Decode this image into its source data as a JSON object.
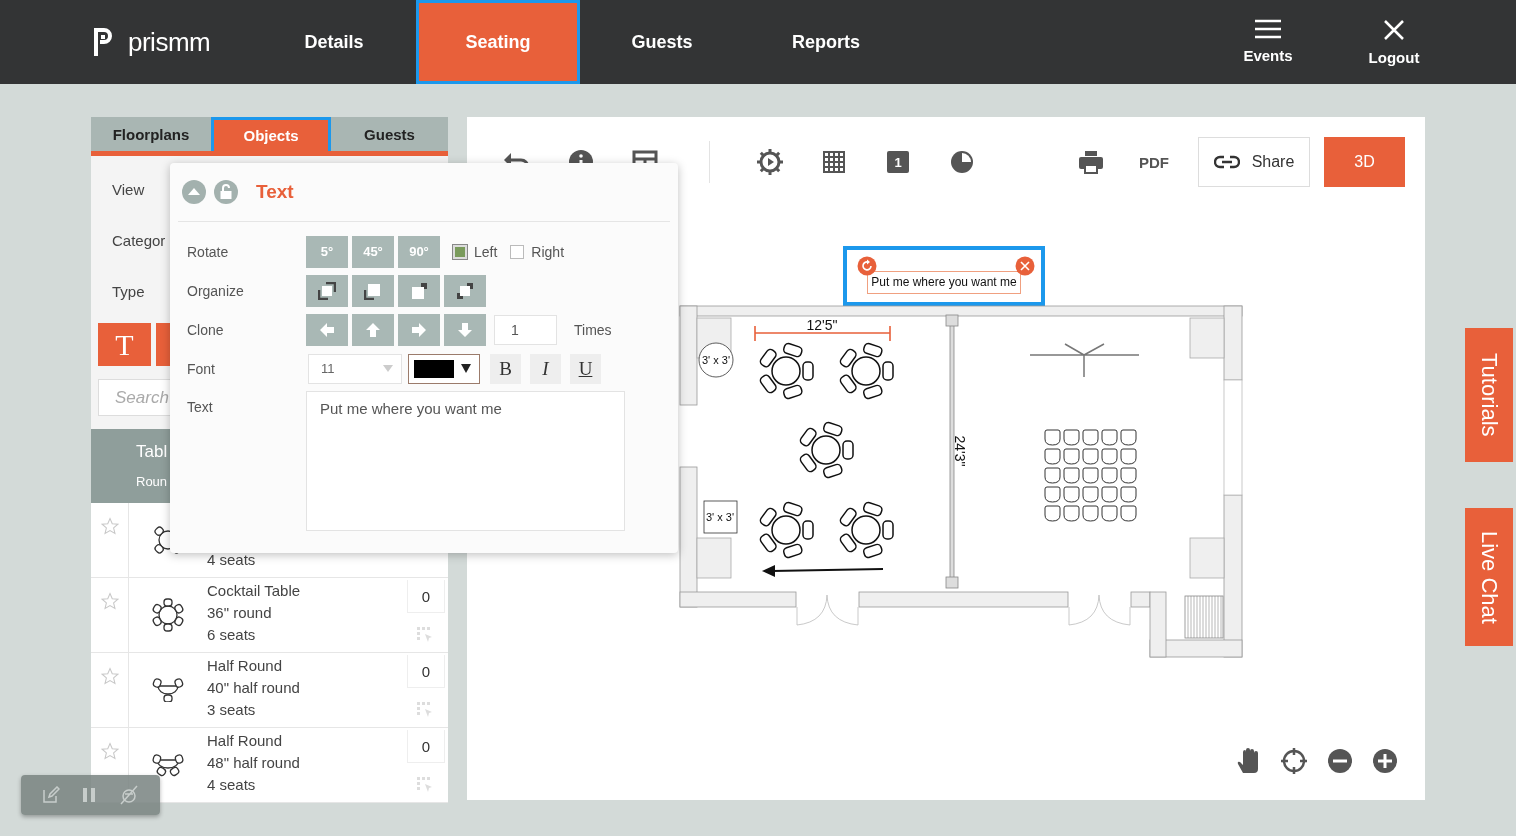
{
  "logo": {
    "text": "prismm"
  },
  "nav": [
    {
      "label": "Details",
      "selected": false,
      "highlighted": false
    },
    {
      "label": "Seating",
      "selected": true,
      "highlighted": true
    },
    {
      "label": "Guests",
      "selected": false,
      "highlighted": false
    },
    {
      "label": "Reports",
      "selected": false,
      "highlighted": false
    }
  ],
  "header_actions": [
    {
      "kind": "menu",
      "label": "Events"
    },
    {
      "kind": "close",
      "label": "Logout"
    }
  ],
  "sidebar": {
    "tabs": [
      {
        "label": "Floorplans",
        "selected": false,
        "highlighted": false
      },
      {
        "label": "Objects",
        "selected": true,
        "highlighted": true
      },
      {
        "label": "Guests",
        "selected": false,
        "highlighted": false
      }
    ],
    "filters": [
      {
        "label": "View"
      },
      {
        "label": "Categor"
      },
      {
        "label": "Type"
      }
    ],
    "type_buttons": [
      {
        "kind": "text",
        "label": "T"
      },
      {
        "kind": "blank"
      }
    ],
    "search": {
      "placeholder": "Search"
    },
    "group": {
      "title": "Tabl",
      "subtitle": "Roun"
    },
    "items": [
      {
        "kind": "round4",
        "lines": [
          "4 seats"
        ]
      },
      {
        "kind": "round6",
        "lines": [
          "Cocktail Table",
          "36\" round",
          "6 seats"
        ],
        "count": "0"
      },
      {
        "kind": "half3",
        "lines": [
          "Half Round",
          "40\" half round",
          "3 seats"
        ],
        "count": "0"
      },
      {
        "kind": "half4",
        "lines": [
          "Half Round",
          "48\" half round",
          "4 seats"
        ],
        "count": "0"
      }
    ]
  },
  "text_editor": {
    "title": "Text",
    "rotate": {
      "label": "Rotate",
      "steps": [
        "5°",
        "45°",
        "90°"
      ],
      "directions": [
        {
          "label": "Left",
          "checked": true
        },
        {
          "label": "Right",
          "checked": false
        }
      ]
    },
    "organize": {
      "label": "Organize"
    },
    "clone": {
      "label": "Clone",
      "value": "1",
      "unit": "Times"
    },
    "font": {
      "label": "Font",
      "size": "11",
      "color": "#000000",
      "styles": [
        "B",
        "I",
        "U"
      ]
    },
    "text": {
      "label": "Text",
      "value": "Put me where you want me"
    }
  },
  "toolbar": [
    {
      "kind": "undo"
    },
    {
      "kind": "info"
    },
    {
      "kind": "layout"
    },
    {
      "kind": "divider"
    },
    {
      "kind": "settings"
    },
    {
      "kind": "grid"
    },
    {
      "kind": "number",
      "label": "1"
    },
    {
      "kind": "pie"
    },
    {
      "kind": "print"
    },
    {
      "kind": "pdf",
      "label": "PDF"
    },
    {
      "kind": "share",
      "label": "Share"
    },
    {
      "kind": "view3d",
      "label": "3D"
    }
  ],
  "canvas": {
    "text_object": {
      "text": "Put me where you want me",
      "highlighted": true
    },
    "floorplan": {
      "width_label": "12'5\"",
      "height_label": "24'3\"",
      "table_labels": [
        "3' x 3'",
        "3' x 3'"
      ]
    }
  },
  "side_tabs": [
    "Tutorials",
    "Live Chat"
  ]
}
